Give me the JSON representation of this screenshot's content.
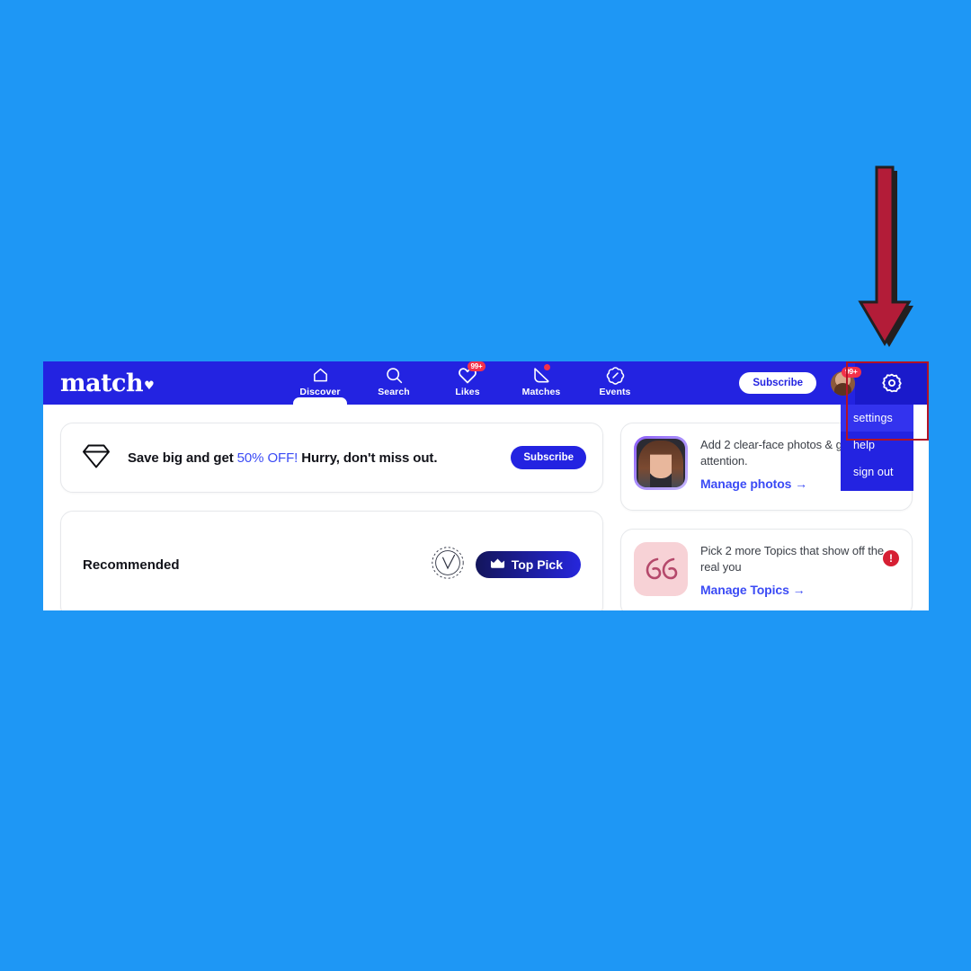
{
  "theme": {
    "page_background": "#1E97F5",
    "brand_blue": "#2323E1",
    "accent_link": "#3B4BF5",
    "badge_red": "#F3304A",
    "annotation_red": "#B31226"
  },
  "navbar": {
    "logo_text": "match",
    "logo_heart": "♥",
    "tabs": [
      {
        "label": "Discover",
        "icon": "home-icon",
        "active": true,
        "badge": ""
      },
      {
        "label": "Search",
        "icon": "search-icon",
        "active": false,
        "badge": ""
      },
      {
        "label": "Likes",
        "icon": "heart-icon",
        "active": false,
        "badge": "99+"
      },
      {
        "label": "Matches",
        "icon": "chat-bubble-icon",
        "active": false,
        "badge": "dot"
      },
      {
        "label": "Events",
        "icon": "ticket-icon",
        "active": false,
        "badge": ""
      }
    ],
    "subscribe_label": "Subscribe",
    "avatar_badge": "99+",
    "gear_icon": "gear-icon"
  },
  "account_menu": {
    "items": [
      {
        "label": "settings",
        "active": true
      },
      {
        "label": "help",
        "active": false
      },
      {
        "label": "sign out",
        "active": false
      }
    ]
  },
  "promo": {
    "icon": "diamond-icon",
    "text_before": "Save big and get ",
    "highlight": "50% OFF!",
    "text_after": " Hurry, don't miss out.",
    "button_label": "Subscribe"
  },
  "recommended": {
    "title": "Recommended",
    "seal_icon": "vaccinated-seal-icon",
    "top_pick_label": "Top Pick",
    "top_pick_icon": "crown-icon"
  },
  "tasks": [
    {
      "thumb": "profile-photo-thumbnail",
      "text": "Add 2 clear-face photos & get more attention.",
      "link_label": "Manage photos →",
      "alert": ""
    },
    {
      "thumb": "quote-marks-icon",
      "text": "Pick 2 more Topics that show off the real you",
      "link_label": "Manage Topics →",
      "alert": "!"
    }
  ],
  "annotations": {
    "arrow": "down-arrow-annotation",
    "highlight": "settings-highlight-box"
  }
}
